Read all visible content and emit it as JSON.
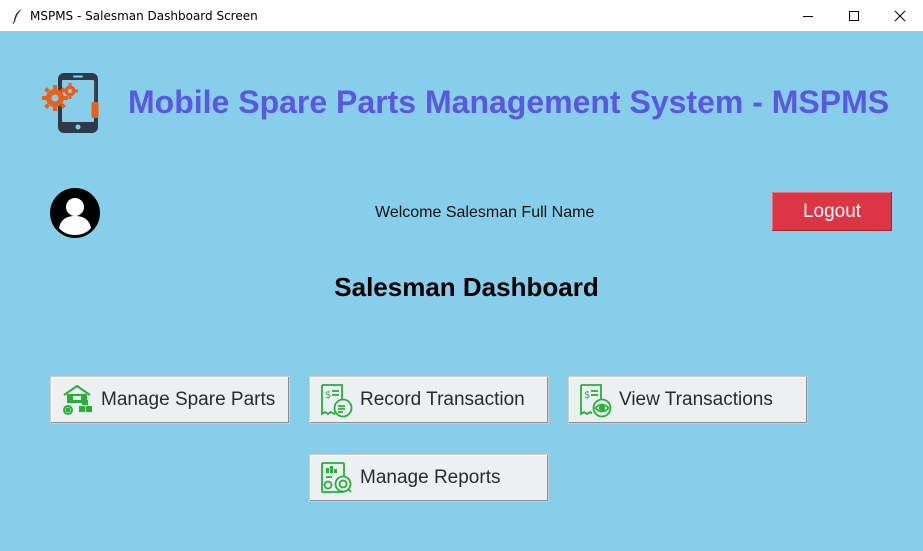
{
  "window": {
    "title": "MSPMS - Salesman Dashboard Screen",
    "app_icon": "feather-icon",
    "controls": [
      "minimize-icon",
      "maximize-icon",
      "close-icon"
    ]
  },
  "header": {
    "app_title": "Mobile Spare Parts Management System - MSPMS",
    "logo_icon": "phone-gears-repair-icon",
    "title_color": "#5b57e0"
  },
  "user": {
    "avatar_icon": "user-avatar-icon",
    "welcome_text": "Welcome Salesman Full Name",
    "logout_label": "Logout",
    "logout_color": "#dc3545"
  },
  "dashboard": {
    "heading": "Salesman Dashboard",
    "background": "#87ceeb",
    "actions": [
      {
        "label": "Manage Spare Parts",
        "icon": "warehouse-gear-icon"
      },
      {
        "label": "Record Transaction",
        "icon": "receipt-cash-icon"
      },
      {
        "label": "View Transactions",
        "icon": "receipt-eye-icon"
      },
      {
        "label": "Manage Reports",
        "icon": "report-chart-icon"
      }
    ],
    "icon_color": "#27ae3b"
  }
}
